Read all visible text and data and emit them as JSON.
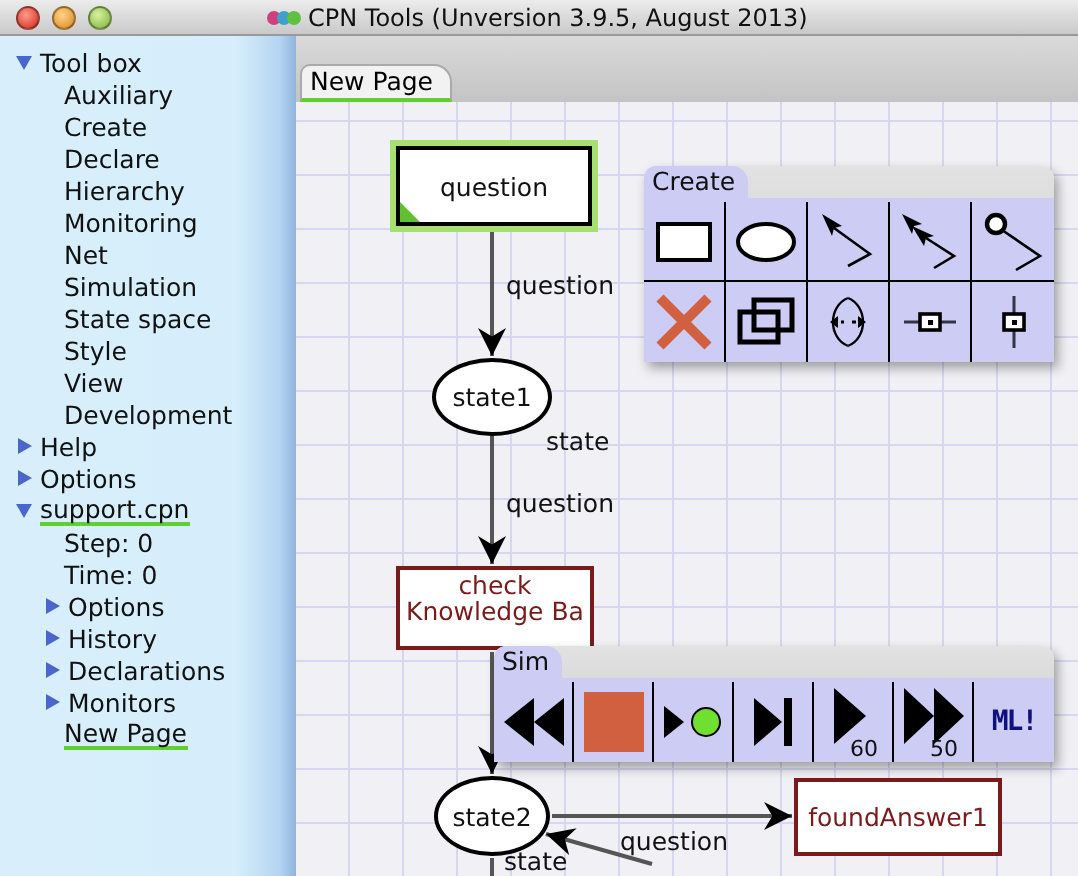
{
  "window": {
    "title": "CPN Tools (Unversion 3.9.5, August 2013)"
  },
  "index": [
    {
      "label": "Tool box",
      "expanded": true,
      "underlined": false,
      "children": [
        {
          "label": "Auxiliary",
          "underlined": false
        },
        {
          "label": "Create",
          "underlined": false
        },
        {
          "label": "Declare",
          "underlined": false
        },
        {
          "label": "Hierarchy",
          "underlined": false
        },
        {
          "label": "Monitoring",
          "underlined": false
        },
        {
          "label": "Net",
          "underlined": false
        },
        {
          "label": "Simulation",
          "underlined": false
        },
        {
          "label": "State space",
          "underlined": false
        },
        {
          "label": "Style",
          "underlined": false
        },
        {
          "label": "View",
          "underlined": false
        },
        {
          "label": "Development",
          "underlined": false
        }
      ]
    },
    {
      "label": "Help",
      "expanded": false,
      "underlined": false
    },
    {
      "label": "Options",
      "expanded": false,
      "underlined": false
    },
    {
      "label": "support.cpn",
      "expanded": true,
      "underlined": true,
      "children": [
        {
          "label": "Step: 0",
          "underlined": false
        },
        {
          "label": "Time: 0",
          "underlined": false
        },
        {
          "label": "Options",
          "expanded": false,
          "underlined": false
        },
        {
          "label": "History",
          "expanded": false,
          "underlined": false
        },
        {
          "label": "Declarations",
          "expanded": false,
          "underlined": false
        },
        {
          "label": "Monitors",
          "expanded": false,
          "underlined": false
        },
        {
          "label": "New Page",
          "underlined": true
        }
      ]
    }
  ],
  "tabs": [
    {
      "label": "New Page",
      "selected": true
    }
  ],
  "net": {
    "transitions": [
      {
        "label": "question",
        "enabled": true
      },
      {
        "label": "check Knowledge Ba",
        "enabled": false
      },
      {
        "label": "foundAnswer1",
        "enabled": false
      }
    ],
    "places": [
      {
        "label": "state1"
      },
      {
        "label": "state2"
      }
    ],
    "arc_labels": [
      "question",
      "state",
      "question",
      "question",
      "state"
    ]
  },
  "create_palette": {
    "title": "Create"
  },
  "sim_palette": {
    "title": "Sim",
    "step_counts": [
      "60",
      "50"
    ],
    "ml_label": "ML!"
  }
}
